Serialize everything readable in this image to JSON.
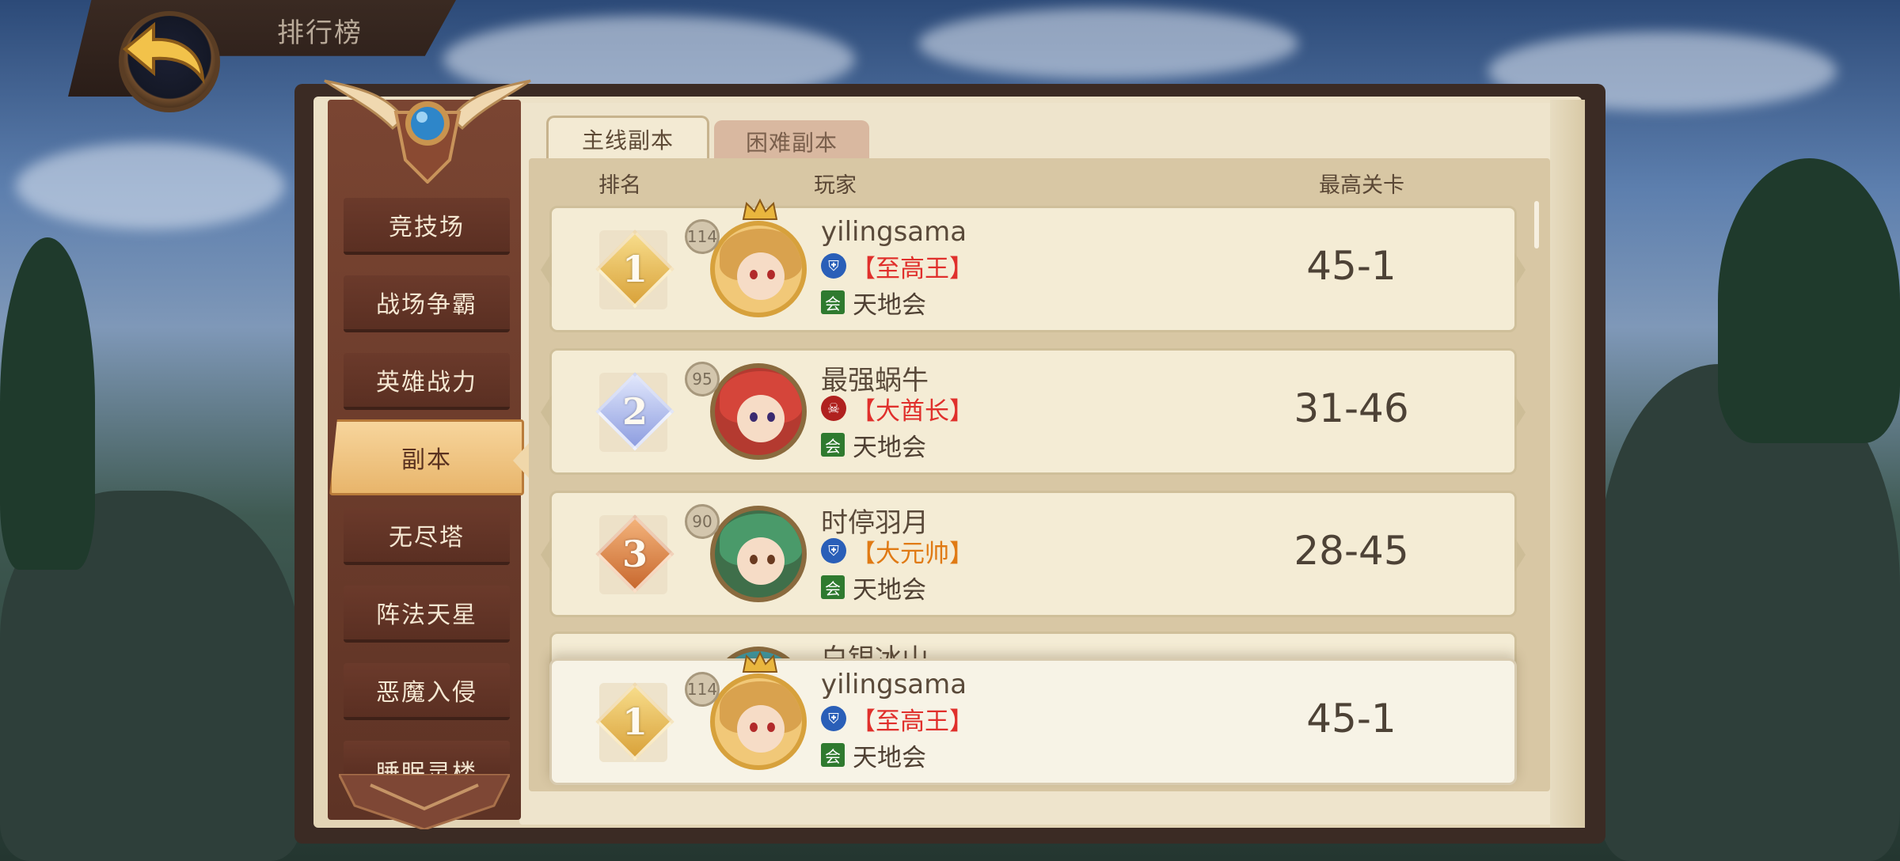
{
  "header": {
    "title": "排行榜"
  },
  "nav": {
    "items": [
      {
        "label": "竞技场"
      },
      {
        "label": "战场争霸"
      },
      {
        "label": "英雄战力"
      },
      {
        "label": "副本"
      },
      {
        "label": "无尽塔"
      },
      {
        "label": "阵法天星"
      },
      {
        "label": "恶魔入侵"
      },
      {
        "label": "睡眠灵楼"
      }
    ],
    "active_label": "副本"
  },
  "tabs": [
    {
      "label": "主线副本",
      "active": true
    },
    {
      "label": "困难副本",
      "active": false
    }
  ],
  "table": {
    "columns": {
      "rank": "排名",
      "player": "玩家",
      "stage": "最高关卡"
    },
    "rows": [
      {
        "rank": "1",
        "level": "114",
        "name": "yilingsama",
        "title": "【至高王】",
        "title_color": "#e0302c",
        "title_icon": "blue-shield-icon",
        "guild": "天地会",
        "stage": "45-1"
      },
      {
        "rank": "2",
        "level": "95",
        "name": "最强蜗牛",
        "title": "【大酋长】",
        "title_color": "#e0302c",
        "title_icon": "red-skull-icon",
        "guild": "天地会",
        "stage": "31-46"
      },
      {
        "rank": "3",
        "level": "90",
        "name": "时停羽月",
        "title": "【大元帅】",
        "title_color": "#e07a14",
        "title_icon": "blue-shield-icon",
        "guild": "天地会",
        "stage": "28-45"
      },
      {
        "name": "白银冰山"
      }
    ],
    "my_row": {
      "rank": "1",
      "level": "114",
      "name": "yilingsama",
      "title": "【至高王】",
      "title_color": "#e0302c",
      "title_icon": "blue-shield-icon",
      "guild": "天地会",
      "stage": "45-1"
    }
  },
  "guild_icon_char": "会",
  "colors": {
    "gold": "#e2b34a",
    "silver": "#9aa8e6",
    "bronze": "#d9884a",
    "nav_bg": "#6b3a2b",
    "paper": "#efe5cd"
  }
}
